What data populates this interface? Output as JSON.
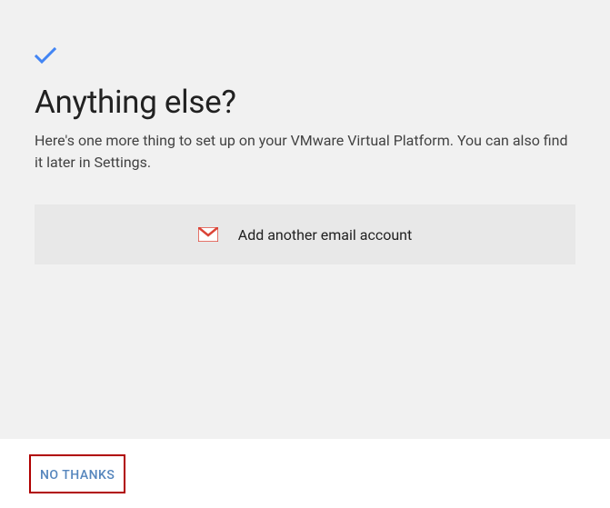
{
  "header": {
    "title": "Anything else?",
    "subtitle": "Here's one more thing to set up on your VMware Virtual Platform. You can also find it later in Settings."
  },
  "option": {
    "label": "Add another email account",
    "icon_name": "gmail-icon"
  },
  "footer": {
    "no_thanks_label": "NO THANKS"
  }
}
